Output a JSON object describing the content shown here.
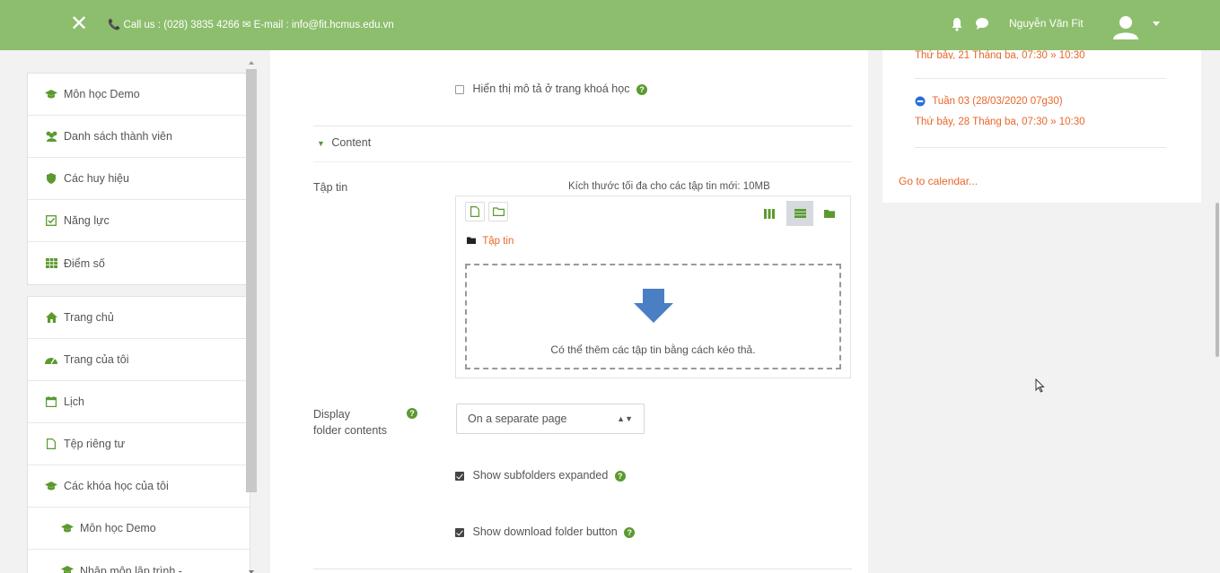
{
  "topbar": {
    "close_symbol": "✕",
    "contact": "📞 Call us : (028) 3835 4266 ✉ E-mail : info@fit.hcmus.edu.vn",
    "user_name": "Nguyễn Văn Fit",
    "bg_color": "#8dbe6e"
  },
  "sidebar": {
    "group1": [
      {
        "label": "Môn học Demo",
        "icon": "graduation-cap-icon"
      },
      {
        "label": "Danh sách thành viên",
        "icon": "users-icon"
      },
      {
        "label": "Các huy hiệu",
        "icon": "shield-icon"
      },
      {
        "label": "Năng lực",
        "icon": "check-square-icon"
      },
      {
        "label": "Điểm số",
        "icon": "table-icon"
      }
    ],
    "group2": [
      {
        "label": "Trang chủ",
        "icon": "home-icon"
      },
      {
        "label": "Trang của tôi",
        "icon": "dashboard-icon"
      },
      {
        "label": "Lịch",
        "icon": "calendar-icon"
      },
      {
        "label": "Tệp riêng tư",
        "icon": "file-icon"
      },
      {
        "label": "Các khóa học của tôi",
        "icon": "graduation-cap-icon"
      },
      {
        "label": "Môn học Demo",
        "icon": "graduation-cap-icon"
      },
      {
        "label": "Nhập môn lập trình -",
        "icon": "graduation-cap-icon"
      }
    ]
  },
  "main": {
    "show_description_label": "Hiển thị mô tả ở trang khoá học",
    "section_content": "Content",
    "files_label": "Tập tin",
    "max_size": "Kích thước tối đa cho các tập tin mới: 10MB",
    "folder_path": "Tập tin",
    "drop_hint": "Có thể thêm các tập tin bằng cách kéo thả.",
    "display_label_1": "Display",
    "display_label_2": "folder contents",
    "display_select": "On a separate page",
    "show_subfolders_label": "Show subfolders expanded",
    "show_download_label": "Show download folder button",
    "show_description_checked": false,
    "show_subfolders_checked": true,
    "show_download_checked": true
  },
  "calendar": {
    "event0_time": "Thứ bảy, 21 Tháng ba, 07:30 » 10:30",
    "event1_title": "Tuần 03 (28/03/2020 07g30)",
    "event1_time": "Thứ bảy, 28 Tháng ba, 07:30 » 10:30",
    "go_to_calendar": "Go to calendar...",
    "accent_color": "#e8672a"
  }
}
